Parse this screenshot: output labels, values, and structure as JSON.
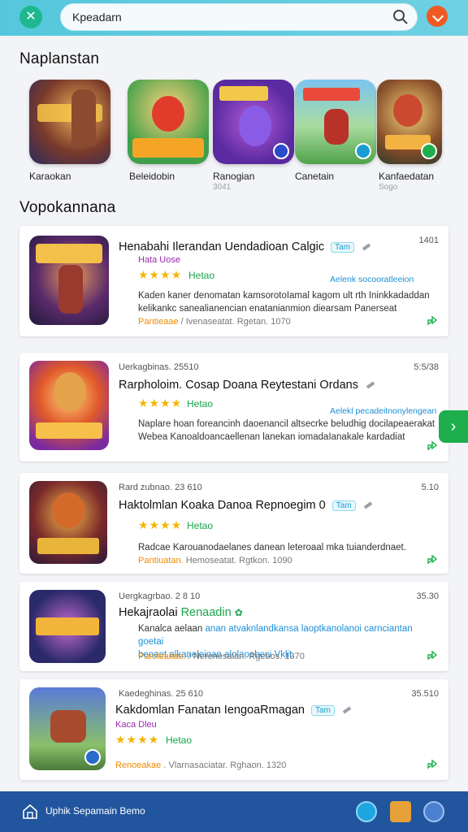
{
  "search": {
    "value": "Kpeadarn",
    "placeholder": ""
  },
  "sections": {
    "featured_title": "Naplanstan",
    "list_title": "Vopokannana"
  },
  "featured": [
    {
      "name": "Karaokan",
      "sub": ""
    },
    {
      "name": "Beleidobin",
      "sub": ""
    },
    {
      "name": "Ranogian",
      "sub": "3041"
    },
    {
      "name": "Canetain",
      "sub": ""
    },
    {
      "name": "Kanfaedatan",
      "sub": "Sogo"
    }
  ],
  "list": [
    {
      "meta_top": "",
      "time": "1401",
      "title": "Henabahi Ilerandan Uendadioan Calgic",
      "tag": "Tam",
      "subtitle": "Hata Uose",
      "stars": "★★★★",
      "stars_label": "Hetao",
      "link": "Aelenk socooratleeion",
      "desc_a": "Kaden kaner denomatan kamsorotoIamal kagom ult rth Ininkkadaddan",
      "desc_b": "kelikankc sanealianencian enatanianmion diearsam Panerseat",
      "desc_hl": "",
      "footer_acc": "Pantieaae",
      "footer_rest": " / Ivenaseatat. Rgetan. 1070"
    },
    {
      "meta_top": "Uerkagbinas. 25510",
      "time": "5:5/38",
      "title": "Rarpholoim. Cosap Doana Reytestani Ordans",
      "tag": "",
      "subtitle": "",
      "stars": "★★★★",
      "stars_label": "Hetao",
      "link": "Aelekl pecadeitnonylengean",
      "desc_a": "Naplare hoan foreancinh daoenancil altsecrke beludhig docilapeaerakat",
      "desc_b": "Webea Kanoaldoancaellenan lanekan iomadaIanakale kardadiat",
      "desc_hl": "",
      "footer_acc": "",
      "footer_rest": ""
    },
    {
      "meta_top": "Rard zubnao. 23 610",
      "time": "5.10",
      "title": "Haktolmlan Koaka Danoa Repnoegim 0",
      "tag": "Tam",
      "subtitle": "",
      "stars": "★★★★",
      "stars_label": "Hetao",
      "link": "",
      "desc_a": "Radcae Karouanodaelanes danean leteroaal mka tuianderdnaet.",
      "desc_b": "",
      "desc_hl": "",
      "footer_acc": "Pantiuatan.",
      "footer_rest": " Hemoseatat. Rgtkon. 1090"
    },
    {
      "meta_top": "Uergkagrbao. 2 8 10",
      "time": "35.30",
      "title": "Hekajraolai",
      "title_green": "Renaadin",
      "tag": "",
      "subtitle": "",
      "stars": "",
      "stars_label": "",
      "link": "",
      "desc_a": "Kanalca aelaan",
      "desc_hl": "anan atvaknlandkansa laoptkanolanoi carnciantan goetai",
      "desc_b": "beoaet alkaneleinan alolaoebeci Vklit.",
      "footer_acc": "Paroleakae.",
      "footer_rest": " / Nerenesaian. Rgebos. 1370"
    },
    {
      "meta_top": "Kaedeghinas. 25 610",
      "time": "35.510",
      "title": "Kakdomlan Fanatan IengoaRmagan",
      "tag": "Tam",
      "subtitle": "Kaca Dleu",
      "stars": "★★★★",
      "stars_label": "Hetao",
      "link": "",
      "desc_a": "",
      "desc_b": "",
      "desc_hl": "",
      "footer_acc": "Renoeakae",
      "footer_rest": " . Vlarnasaciatar. Rghaon. 1320"
    }
  ],
  "bottom": {
    "label": "Uphik Sepamain Bemo"
  },
  "icons": {
    "close": "close-icon",
    "search": "search-icon",
    "next": "chevron-right-icon",
    "share": "share-icon",
    "home": "home-icon"
  },
  "colors": {
    "accent": "#1eae4e",
    "topbar": "#55c7dc",
    "bottombar": "#21569e"
  }
}
